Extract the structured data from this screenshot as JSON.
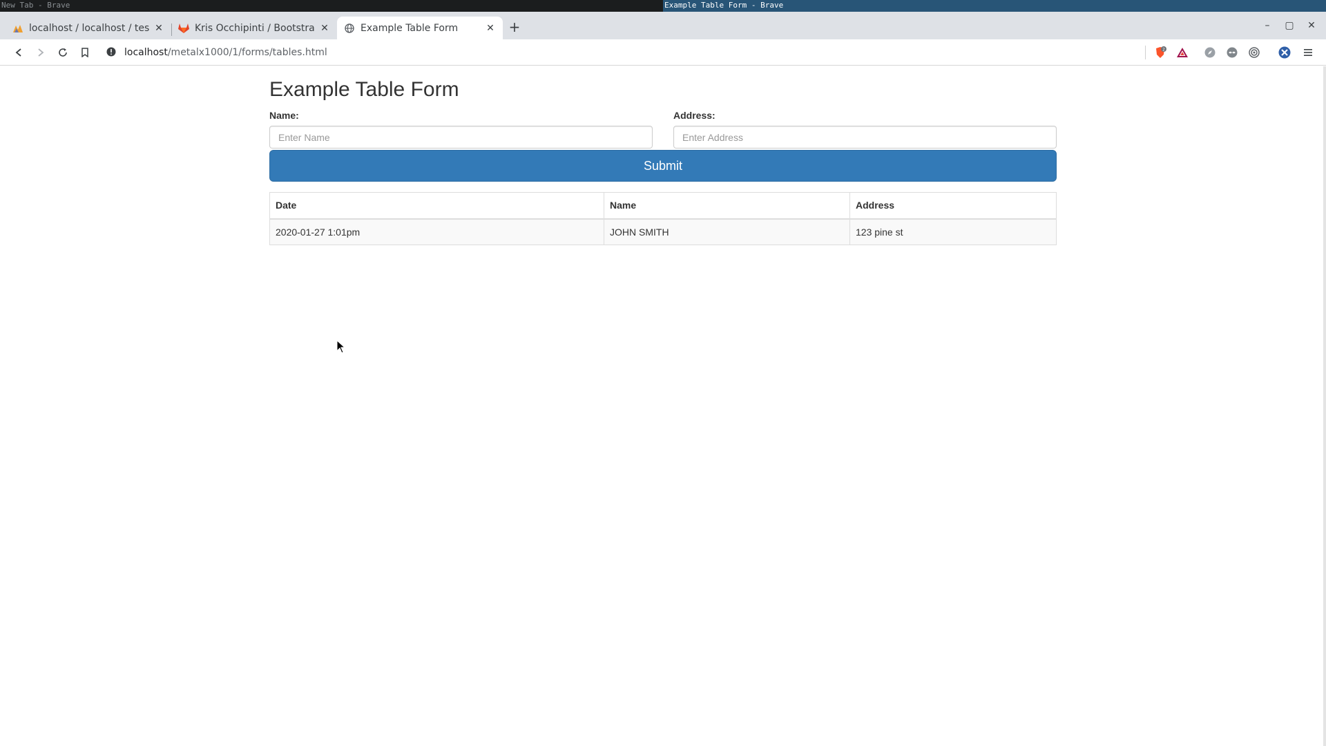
{
  "system_bar": {
    "left_title": "New Tab - Brave",
    "active_title": "Example Table Form - Brave"
  },
  "browser": {
    "tabs": [
      {
        "label": "localhost / localhost / test / ",
        "icon": "phpmyadmin-icon"
      },
      {
        "label": "Kris Occhipinti / Bootstrap-F",
        "icon": "gitlab-icon"
      },
      {
        "label": "Example Table Form",
        "icon": "globe-icon"
      }
    ],
    "url_host": "localhost",
    "url_path": "/metalx1000/1/forms/tables.html",
    "brave_shield_count": "2"
  },
  "page": {
    "title": "Example Table Form",
    "name_label": "Name:",
    "name_placeholder": "Enter Name",
    "address_label": "Address:",
    "address_placeholder": "Enter Address",
    "submit_label": "Submit",
    "table": {
      "headers": [
        "Date",
        "Name",
        "Address"
      ],
      "rows": [
        [
          "2020-01-27 1:01pm",
          "JOHN SMITH",
          "123 pine st"
        ]
      ]
    }
  },
  "colors": {
    "primary": "#337ab7",
    "sysbar_active": "#285577"
  }
}
